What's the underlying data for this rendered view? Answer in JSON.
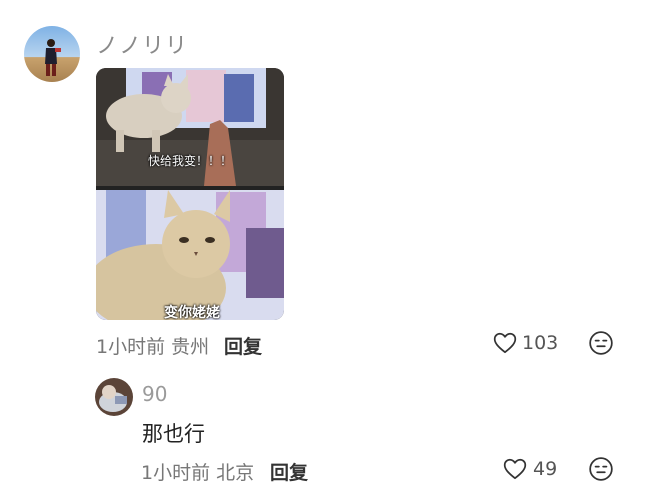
{
  "comment": {
    "username": "ノノリリ",
    "meme": {
      "caption_top": "快给我变！！！",
      "caption_bottom": "变你姥姥"
    },
    "meta": "1小时前 贵州",
    "reply_label": "回复",
    "like_count": "103"
  },
  "reply": {
    "username": "90",
    "text": "那也行",
    "meta": "1小时前 北京",
    "reply_label": "回复",
    "like_count": "49"
  },
  "icons": {
    "like": "heart-outline-icon",
    "emoji": "neutral-face-icon"
  }
}
